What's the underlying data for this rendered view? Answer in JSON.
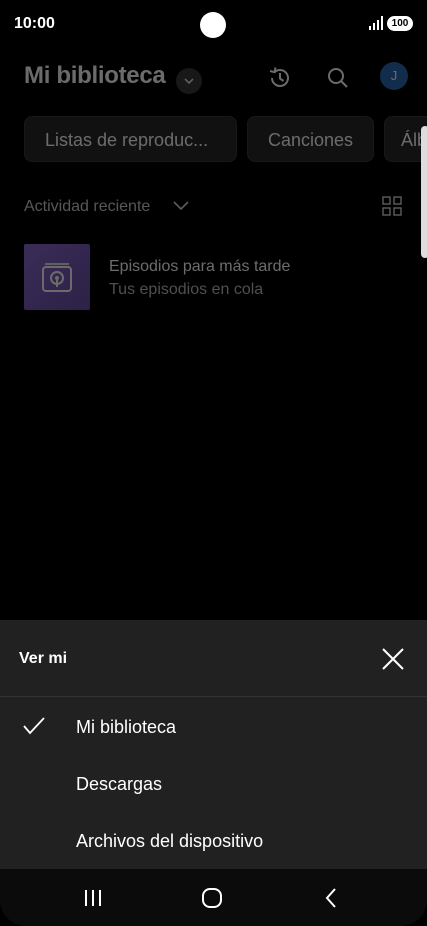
{
  "status_bar": {
    "time": "10:00",
    "battery": "100"
  },
  "header": {
    "title": "Mi biblioteca",
    "avatar_letter": "J"
  },
  "chips": [
    {
      "label": "Listas de reproduc..."
    },
    {
      "label": "Canciones"
    },
    {
      "label": "Álb"
    }
  ],
  "sort": {
    "label": "Actividad reciente"
  },
  "items": [
    {
      "title": "Episodios para más tarde",
      "subtitle": "Tus episodios en cola"
    }
  ],
  "sheet": {
    "title": "Ver mi",
    "options": [
      {
        "label": "Mi biblioteca",
        "selected": true
      },
      {
        "label": "Descargas",
        "selected": false
      },
      {
        "label": "Archivos del dispositivo",
        "selected": false
      }
    ]
  },
  "icons": {
    "history": "history-icon",
    "search": "search-icon",
    "grid": "grid-view-icon",
    "close": "close-icon",
    "check": "check-icon",
    "recents": "recents-icon",
    "home": "home-icon",
    "back": "back-icon"
  }
}
